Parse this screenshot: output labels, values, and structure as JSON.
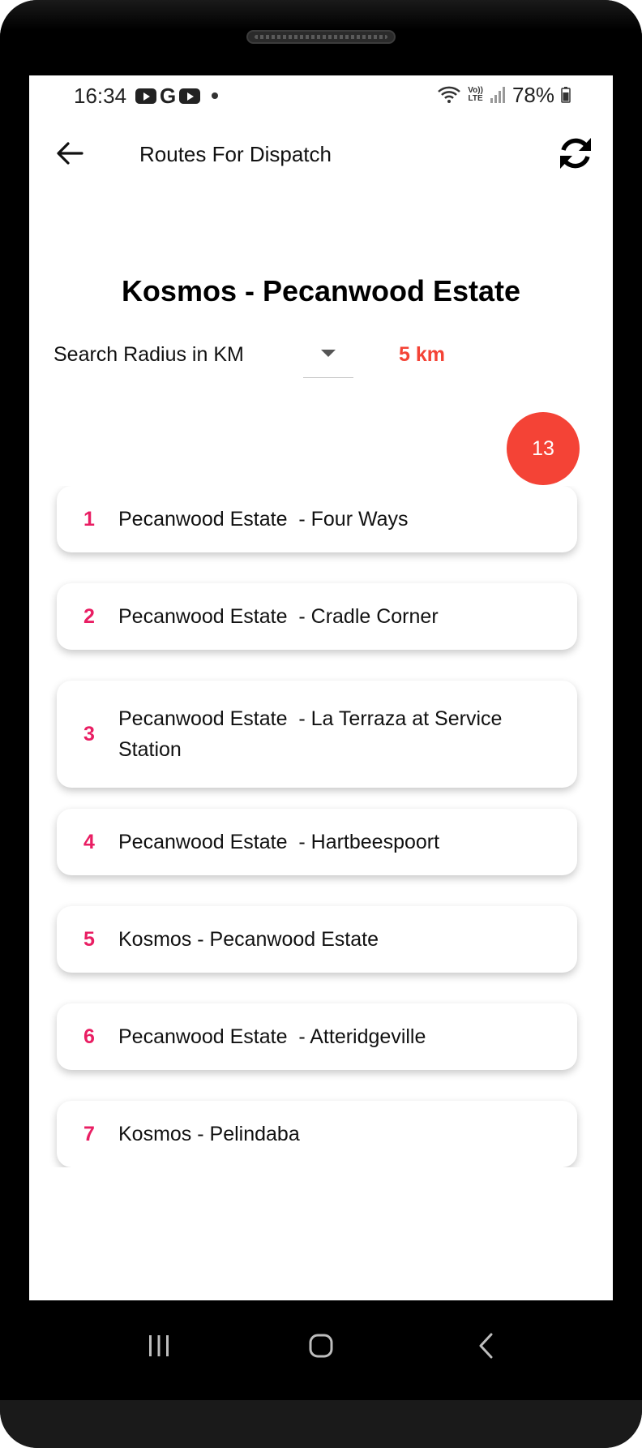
{
  "status_bar": {
    "time": "16:34",
    "left_icons": [
      "youtube-icon",
      "google-icon",
      "youtube-icon",
      "dot-icon"
    ],
    "right_icons": [
      "wifi-icon",
      "volte-icon",
      "signal-icon",
      "battery-icon"
    ],
    "volte_label": "Vo)) LTE",
    "battery": "78%"
  },
  "app_bar": {
    "title": "Routes For Dispatch",
    "back_icon": "arrow-left-icon",
    "refresh_icon": "refresh-icon"
  },
  "page_title": "Kosmos - Pecanwood Estate",
  "search": {
    "label": "Search Radius in KM",
    "value": "5 km"
  },
  "route_count": "13",
  "routes": [
    {
      "num": "1",
      "name": "Pecanwood Estate  - Four Ways"
    },
    {
      "num": "2",
      "name": "Pecanwood Estate  - Cradle Corner"
    },
    {
      "num": "3",
      "name": "Pecanwood Estate  - La Terraza at Service Station"
    },
    {
      "num": "4",
      "name": "Pecanwood Estate  - Hartbeespoort"
    },
    {
      "num": "5",
      "name": "Kosmos - Pecanwood Estate"
    },
    {
      "num": "6",
      "name": "Pecanwood Estate  - Atteridgeville"
    },
    {
      "num": "7",
      "name": "Kosmos - Pelindaba"
    }
  ],
  "colors": {
    "accent_red": "#f44336",
    "index_pink": "#e91e63"
  },
  "nav_bar": [
    "recents-icon",
    "home-icon",
    "back-icon"
  ]
}
